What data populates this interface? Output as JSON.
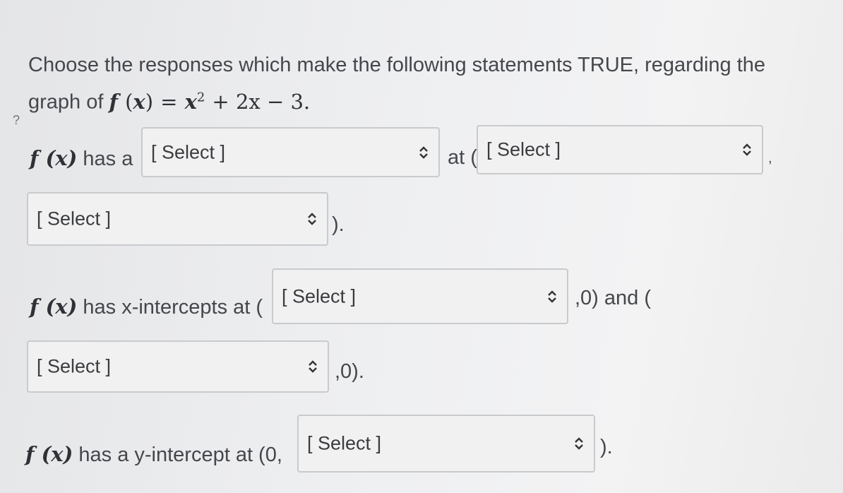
{
  "instructions": {
    "line1": "Choose the responses which make the following statements TRUE, regarding the",
    "line2_prefix": "graph of",
    "function": {
      "f": "f",
      "x": "x",
      "eq": "=",
      "x2": "x",
      "exp": "2",
      "rest": "+ 2x − 3."
    }
  },
  "q1": {
    "fx": "f (x)",
    "prefix": "has a",
    "mid": "at (",
    "tail": ",",
    "end": ").",
    "select1": "[ Select ]",
    "select2": "[ Select ]",
    "select3": "[ Select ]"
  },
  "q2": {
    "fx": "f (x)",
    "prefix": "has x-intercepts at (",
    "mid": ",0) and (",
    "end": ",0).",
    "select1": "[ Select ]",
    "select2": "[ Select ]"
  },
  "q3": {
    "fx": "f (x)",
    "prefix": "has a y-intercept at (0,",
    "end": ").",
    "select1": "[ Select ]"
  },
  "margin_mark": "?",
  "chevron_icon": "up-down-chevron-icon"
}
